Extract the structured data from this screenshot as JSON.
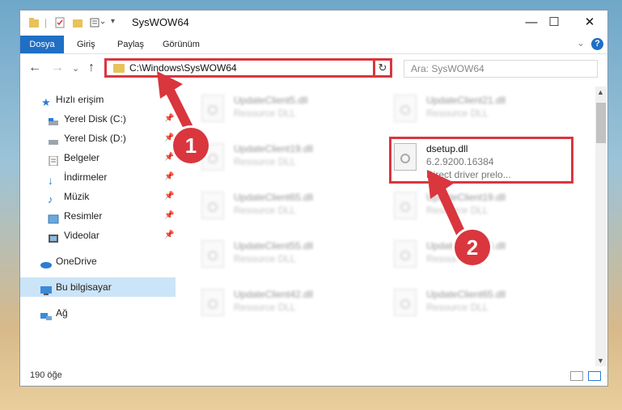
{
  "window": {
    "title": "SysWOW64",
    "controls": {
      "minimize": "—",
      "maximize": "☐",
      "close": "✕"
    }
  },
  "ribbon": {
    "tabs": [
      {
        "label": "Dosya",
        "active": true
      },
      {
        "label": "Giriş"
      },
      {
        "label": "Paylaş"
      },
      {
        "label": "Görünüm"
      }
    ],
    "help": "?",
    "expand": "⌄"
  },
  "navbar": {
    "back": "←",
    "forward": "→",
    "recent": "⌄",
    "up": "↑",
    "address": "C:\\Windows\\SysWOW64",
    "address_dropdown": "⌄",
    "refresh": "↻",
    "search_placeholder": "Ara: SysWOW64"
  },
  "sidebar": {
    "items": [
      {
        "label": "Hızlı erişim",
        "icon": "star-icon",
        "pinned": false
      },
      {
        "label": "Yerel Disk (C:)",
        "icon": "drive-icon",
        "pinned": true
      },
      {
        "label": "Yerel Disk (D:)",
        "icon": "drive-icon",
        "pinned": true
      },
      {
        "label": "Belgeler",
        "icon": "documents-icon",
        "pinned": true
      },
      {
        "label": "İndirmeler",
        "icon": "download-icon",
        "pinned": true
      },
      {
        "label": "Müzik",
        "icon": "music-icon",
        "pinned": true
      },
      {
        "label": "Resimler",
        "icon": "pictures-icon",
        "pinned": true
      },
      {
        "label": "Videolar",
        "icon": "video-icon",
        "pinned": true
      },
      {
        "label": "OneDrive",
        "icon": "cloud-icon",
        "pinned": false
      },
      {
        "label": "Bu bilgisayar",
        "icon": "computer-icon",
        "pinned": false,
        "selected": true
      },
      {
        "label": "Ağ",
        "icon": "network-icon",
        "pinned": false
      }
    ]
  },
  "files": [
    {
      "name": "UpdateClient5.dll",
      "desc": "Resource DLL"
    },
    {
      "name": "UpdateClient21.dll",
      "desc": "Resource DLL"
    },
    {
      "name": "UpdateClient19.dll",
      "desc": "Resource DLL"
    },
    {
      "name": "dsetup.dll",
      "desc": "6.2.9200.16384",
      "desc2": "Direct driver prelo..."
    },
    {
      "name": "UpdateClient65.dll",
      "desc": "Resource DLL"
    },
    {
      "name": "UpdateClient19.dll",
      "desc": "Resource DLL"
    },
    {
      "name": "UpdateClient55.dll",
      "desc": "Resource DLL"
    },
    {
      "name": "UpdateClient63.dll",
      "desc": "Resource DLL"
    },
    {
      "name": "UpdateClient42.dll",
      "desc": "Resource DLL"
    },
    {
      "name": "UpdateClient65.dll",
      "desc": "Resource DLL"
    }
  ],
  "status": {
    "count": "190 öğe"
  },
  "annotations": {
    "step1": "1",
    "step2": "2",
    "accent": "#d9363e"
  }
}
